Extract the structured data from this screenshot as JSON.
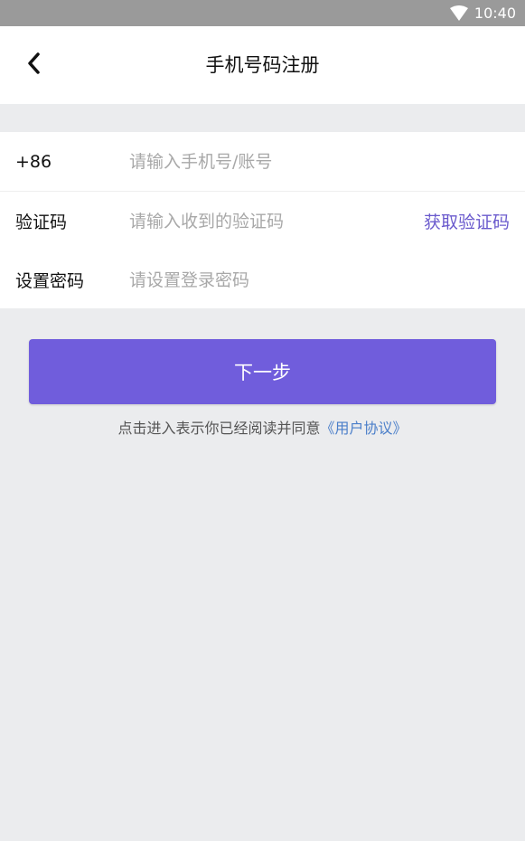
{
  "status_bar": {
    "time": "10:40",
    "icons": [
      "wifi-icon"
    ]
  },
  "header": {
    "title": "手机号码注册",
    "back_icon": "chevron-left-icon"
  },
  "form": {
    "phone": {
      "prefix": "+86",
      "placeholder": "请输入手机号/账号",
      "value": ""
    },
    "code": {
      "label": "验证码",
      "placeholder": "请输入收到的验证码",
      "value": "",
      "get_code_label": "获取验证码"
    },
    "password": {
      "label": "设置密码",
      "placeholder": "请设置登录密码",
      "value": ""
    }
  },
  "actions": {
    "next_label": "下一步"
  },
  "agreement": {
    "text": "点击进入表示你已经阅读并同意",
    "link": "《用户协议》"
  },
  "colors": {
    "accent": "#705ddc",
    "link_purple": "#6a5acd",
    "link_blue": "#4a7ec9",
    "background": "#ebecee",
    "status_bar": "#9a9a9a"
  }
}
